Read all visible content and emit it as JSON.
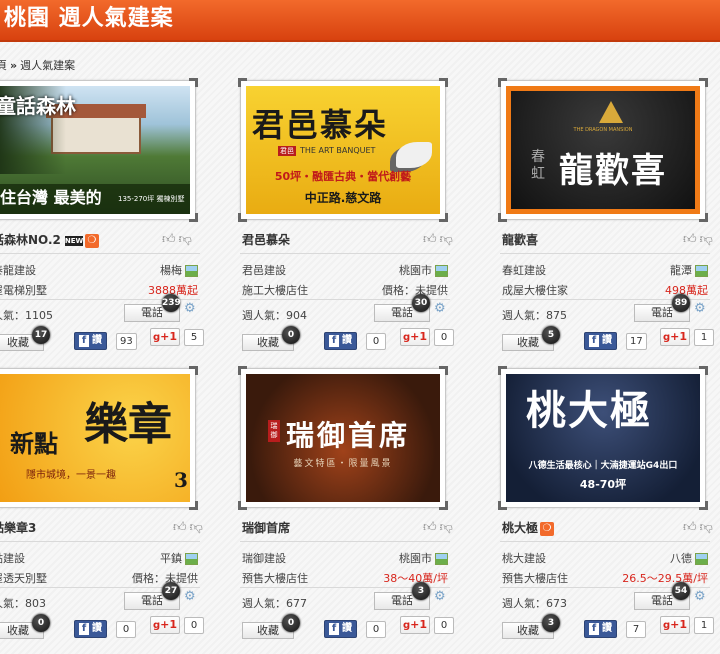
{
  "header": {
    "title": "桃園 週人氣建案"
  },
  "breadcrumb": {
    "home": "頁",
    "sep": "»",
    "current": "週人氣建案"
  },
  "labels": {
    "tel": "電話",
    "fav": "收藏",
    "fb": "讚",
    "gplus": "+1",
    "fb_f": "f"
  },
  "cards": [
    {
      "name": "話森林NO.2",
      "builder": "泰龍建設",
      "city": "楊梅",
      "type": "屋電梯別墅",
      "price": "3888萬起",
      "popularity": "人氣：1105",
      "tel_badge": "239",
      "fav_badge": "17",
      "fb_count": "93",
      "gplus_count": "5",
      "image_text": {
        "top": "童話森林",
        "bottom": "住台灣 最美的",
        "small": "135-270坪 獨棟別墅"
      },
      "colors": {
        "bg": "#2c4a22"
      }
    },
    {
      "name": "君邑慕朵",
      "builder": "君邑建設",
      "city": "桃園市",
      "type": "施工大樓店住",
      "price": "價格：未提供",
      "popularity": "週人氣：904",
      "tel_badge": "30",
      "fav_badge": "0",
      "fb_count": "0",
      "gplus_count": "0",
      "image_text": {
        "top": "君邑慕朵",
        "sub": "THE ART BANQUET",
        "line1": "50坪・融匯古典・當代創藝",
        "line2": "中正路.慈文路",
        "logo": "君邑"
      },
      "colors": {
        "bg": "#f2c21a"
      }
    },
    {
      "name": "龍歡喜",
      "builder": "春虹建設",
      "city": "龍潭",
      "type": "成屋大樓住家",
      "price": "498萬起",
      "popularity": "週人氣：875",
      "tel_badge": "89",
      "fav_badge": "5",
      "fb_count": "17",
      "gplus_count": "1",
      "image_text": {
        "top": "龍歡喜",
        "left1": "春",
        "left2": "虹",
        "tiny": "THE DRAGON MANSION"
      },
      "colors": {
        "bg": "#1d1d1d"
      }
    },
    {
      "name": "點樂章3",
      "builder": "點建設",
      "city": "平鎮",
      "type": "屋透天別墅",
      "price": "價格：未提供",
      "popularity": "人氣：803",
      "tel_badge": "27",
      "fav_badge": "0",
      "fb_count": "0",
      "gplus_count": "0",
      "image_text": {
        "top": "新點",
        "big": "樂章",
        "num": "3",
        "sub": "隱市城境，一景一趣"
      },
      "colors": {
        "bg": "#f5b51b"
      }
    },
    {
      "name": "瑞御首席",
      "builder": "瑞御建設",
      "city": "桃園市",
      "type": "預售大樓店住",
      "price": "38～40萬/坪",
      "popularity": "週人氣：677",
      "tel_badge": "3",
      "fav_badge": "0",
      "fb_count": "0",
      "gplus_count": "0",
      "image_text": {
        "top": "瑞御首席",
        "sub": "藝文特區・限量風景",
        "seal": "瑞御"
      },
      "colors": {
        "bg": "#3a1a0c"
      }
    },
    {
      "name": "桃大極",
      "builder": "桃大建設",
      "city": "八德",
      "type": "預售大樓店住",
      "price": "26.5～29.5萬/坪",
      "popularity": "週人氣：673",
      "tel_badge": "54",
      "fav_badge": "3",
      "fb_count": "7",
      "gplus_count": "1",
      "image_text": {
        "top": "桃大極",
        "line1": "八德生活最核心｜大湳捷運站G4出口",
        "line2": "48-70坪"
      },
      "colors": {
        "bg": "#1b2a44"
      }
    }
  ]
}
